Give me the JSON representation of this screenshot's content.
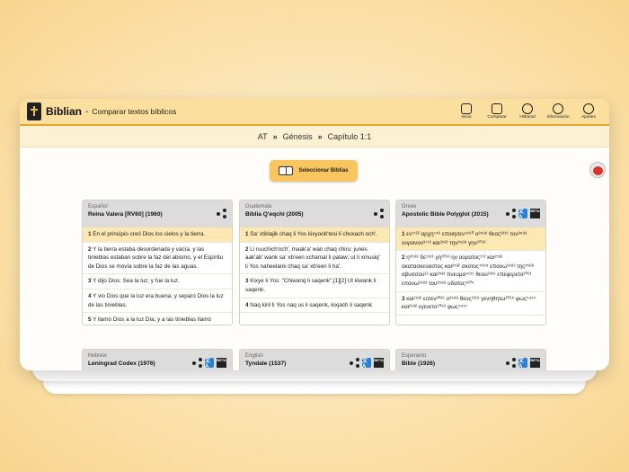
{
  "app": {
    "name": "Biblian",
    "separator": "-",
    "subtitle": "Comparar textos bíblicos"
  },
  "nav": [
    {
      "label": "Inicio",
      "icon": "home-icon"
    },
    {
      "label": "Comparar",
      "icon": "compare-icon"
    },
    {
      "label": "Historial",
      "icon": "history-icon"
    },
    {
      "label": "Información",
      "icon": "info-icon"
    },
    {
      "label": "Ajustes",
      "icon": "gear-icon"
    }
  ],
  "breadcrumb": {
    "testament": "AT",
    "book": "Génesis",
    "chapter": "Capítulo 1:1"
  },
  "select_button": "Seleccionar Biblias",
  "translate_label": "文A",
  "beta_label": "BETA",
  "cards": [
    {
      "lang": "Español",
      "title": "Reina Valera [RV60] (1960)",
      "verses": [
        {
          "n": "1",
          "text": "En el principio creó Dios los cielos y la tierra."
        },
        {
          "n": "2",
          "text": "Y la tierra estaba desordenada y vacía, y las tinieblas estaban sobre la faz del abismo, y el Espíritu de Dios se movía sobre la faz de las aguas."
        },
        {
          "n": "3",
          "text": "Y dijo Dios: Sea la luz; y fue la luz."
        },
        {
          "n": "4",
          "text": "Y vio Dios que la luz era buena; y separó Dios la luz de las tinieblas."
        },
        {
          "n": "5",
          "text": "Y llamó Dios a la luz Día, y a las tinieblas llamó"
        }
      ]
    },
    {
      "lang": "Guatemala",
      "title": "Biblia Q'eqchi (2005)",
      "verses": [
        {
          "n": "1",
          "text": "Sa' xtiklajik chaq li Yos kixyoob'tesi li choxach och'."
        },
        {
          "n": "2",
          "text": "Li ruuchich'och', maak'a' wan chaq chiru: junes aak'ab' wank sa' xb'een xchamal li palaw; ut li xmusiq' li Yos naheelank chaq sa' xb'een li ha'."
        },
        {
          "n": "3",
          "text": "Kixye li Yos: \"Chiwanq li saqenk\".[1][2] Ut kiwank li saqenk."
        },
        {
          "n": "4",
          "text": "Naq kiril li Yos naq us li saqenk, kixjach li saqenk"
        }
      ]
    },
    {
      "lang": "Greek",
      "title": "Apostolic Bible Polyglot (2015)",
      "verses": [
        {
          "n": "1",
          "text": "εν¹⁷²² αρχη⁷⁴⁶ εποιησεν⁴¹⁶⁰ ο³⁵⁸⁸ θεος²³¹⁶ τον³⁵⁸⁸ ουρανον³⁷⁷² και²⁵³² την³⁵⁸⁸ γην¹⁰⁹³"
        },
        {
          "n": "2",
          "text": "η³⁵⁸⁸ δε¹¹⁶¹ γη¹⁰⁹³ ην αορατος¹⁷² και²⁵³² ακατασκευαστος και²⁵³² σκοτος⁴⁶⁵⁵ επανω¹⁸⁸³ της³⁵⁸⁸ αβυσσου¹² και²⁵³² πνευμα⁴¹⁵¹ θεου²³¹⁶ επεφερετο²⁰¹³ επανω¹⁸⁸³ του³⁵⁸⁸ υδατος⁵²⁰⁴"
        },
        {
          "n": "3",
          "text": "και²⁵³² ειπεν²⁰³⁶ ο³⁵⁸⁸ θεος²³¹⁶ γενηθητω¹⁰⁹⁶ φως⁵⁴⁵⁷ και²⁵³² εγενετο¹⁰⁹⁶ φως⁵⁴⁵⁷"
        }
      ]
    },
    {
      "lang": "Hebrew",
      "title": "Leningrad Codex (1976)"
    },
    {
      "lang": "English",
      "title": "Tyndale (1537)"
    },
    {
      "lang": "Esperanto",
      "title": "Bible (1926)"
    }
  ]
}
